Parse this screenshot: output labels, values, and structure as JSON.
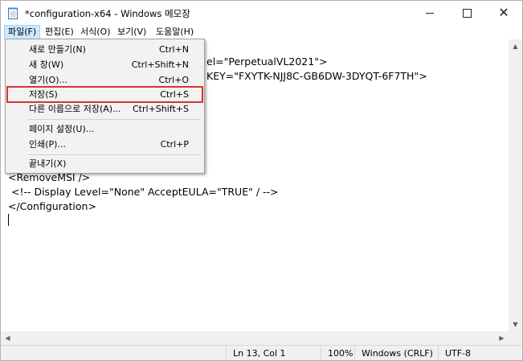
{
  "window": {
    "title": "*configuration-x64 - Windows 메모장",
    "minimize_glyph": "—",
    "close_glyph": "✕"
  },
  "menubar": [
    {
      "label": "파일(F)"
    },
    {
      "label": "편집(E)"
    },
    {
      "label": "서식(O)"
    },
    {
      "label": "보기(V)"
    },
    {
      "label": "도움말(H)"
    }
  ],
  "file_menu": {
    "items": [
      {
        "label": "새로 만들기(N)",
        "shortcut": "Ctrl+N"
      },
      {
        "label": "새 창(W)",
        "shortcut": "Ctrl+Shift+N"
      },
      {
        "label": "열기(O)...",
        "shortcut": "Ctrl+O"
      },
      {
        "label": "저장(S)",
        "shortcut": "Ctrl+S",
        "highlighted": true
      },
      {
        "label": "다른 이름으로 저장(A)...",
        "shortcut": "Ctrl+Shift+S"
      },
      {
        "label": "페이지 설정(U)...",
        "shortcut": ""
      },
      {
        "label": "인쇄(P)...",
        "shortcut": "Ctrl+P"
      },
      {
        "label": "끝내기(X)",
        "shortcut": ""
      }
    ]
  },
  "editor": {
    "visible_lines": [
      "el=\"PerpetualVL2021\">",
      "KEY=\"FXYTK-NJJ8C-GB6DW-3DYQT-6F7TH\">",
      "<RemoveMSI />",
      " <!-- Display Level=\"None\" AcceptEULA=\"TRUE\" / -->",
      "</Configuration>"
    ]
  },
  "scrollbars": {
    "up_arrow": "▲",
    "down_arrow": "▼",
    "left_arrow": "◀",
    "right_arrow": "▶"
  },
  "statusbar": {
    "position": "Ln 13, Col 1",
    "zoom": "100%",
    "line_ending": "Windows (CRLF)",
    "encoding": "UTF-8"
  },
  "colors": {
    "highlight_border": "#d9342b",
    "menu_active_bg": "#cce8ff"
  }
}
